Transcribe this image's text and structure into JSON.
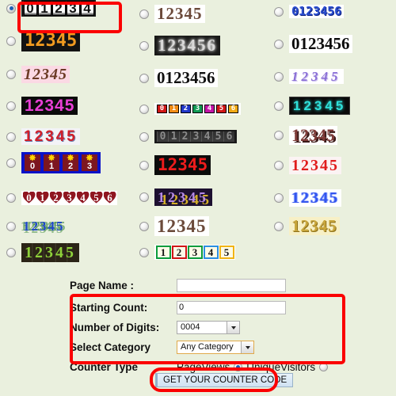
{
  "page": {
    "background_color": "#eaf0de",
    "highlight_color": "#fb0000"
  },
  "gallery": {
    "columns": [
      {
        "name": "column-1",
        "items": [
          {
            "id": "odometer-white",
            "sample": "01234",
            "digits": [
              "0",
              "1",
              "2",
              "3",
              "4"
            ],
            "selected": true,
            "highlighted": true
          },
          {
            "id": "lcd-orange",
            "sample": "12345",
            "selected": false
          },
          {
            "id": "lipstick-pink",
            "sample": "12345",
            "selected": false
          },
          {
            "id": "neon-magenta",
            "sample": "12345",
            "selected": false
          },
          {
            "id": "red-3d",
            "sample": "12345",
            "selected": false
          },
          {
            "id": "flower-pots-blue",
            "sample": "0123",
            "digits": [
              "0",
              "1",
              "2",
              "3"
            ],
            "selected": false
          },
          {
            "id": "hearts-red",
            "sample": "0123456",
            "digits": [
              "0",
              "1",
              "2",
              "3",
              "4",
              "5",
              "6"
            ],
            "selected": false
          },
          {
            "id": "christmas-trees",
            "sample": "12345",
            "selected": false
          },
          {
            "id": "grass-green-dark",
            "sample": "12345",
            "selected": false
          }
        ]
      },
      {
        "name": "column-2",
        "items": [
          {
            "id": "brown-serif",
            "sample": "12345",
            "selected": false
          },
          {
            "id": "smoke-black",
            "sample": "123456",
            "selected": false
          },
          {
            "id": "stencil-bold",
            "sample": "0123456",
            "selected": false
          },
          {
            "id": "color-blocks",
            "sample": "0123456",
            "digits": [
              "0",
              "1",
              "2",
              "3",
              "4",
              "5",
              "6"
            ],
            "selected": false
          },
          {
            "id": "mechanical-dark",
            "sample": "0123456",
            "digits": [
              "0",
              "1",
              "2",
              "3",
              "4",
              "5",
              "6"
            ],
            "selected": false
          },
          {
            "id": "led-red",
            "sample": "12345",
            "selected": false
          },
          {
            "id": "stars-purple",
            "sample": "12345",
            "selected": false
          },
          {
            "id": "brown-bold",
            "sample": "12345",
            "selected": false
          },
          {
            "id": "playing-cards",
            "sample": "12345",
            "digits": [
              "1",
              "2",
              "3",
              "4",
              "5"
            ],
            "selected": false
          }
        ]
      },
      {
        "name": "column-3",
        "items": [
          {
            "id": "pixel-blue",
            "sample": "0123456",
            "selected": false
          },
          {
            "id": "bodoni-black",
            "sample": "0123456",
            "selected": false
          },
          {
            "id": "violet-italic",
            "sample": "12345",
            "selected": false
          },
          {
            "id": "cyan-glow",
            "sample": "12345",
            "selected": false
          },
          {
            "id": "maroon-shadow",
            "sample": "12345",
            "selected": false
          },
          {
            "id": "red-serif",
            "sample": "12345",
            "selected": false
          },
          {
            "id": "blue-dotted",
            "sample": "12345",
            "selected": false
          },
          {
            "id": "gold-mesh",
            "sample": "12345",
            "selected": false
          }
        ]
      }
    ]
  },
  "form": {
    "page_name": {
      "label": "Page Name :",
      "value": ""
    },
    "starting_count": {
      "label": "Starting Count:",
      "value": "0"
    },
    "number_of_digits": {
      "label": "Number of Digits:",
      "value": "0004"
    },
    "select_category": {
      "label": "Select Category",
      "value": "Any Category"
    },
    "counter_type": {
      "label": "Counter Type",
      "option_pageviews": "PageViews",
      "option_uniquevisitors": "UniqueVisitors",
      "selected": "PageViews"
    },
    "submit_button": {
      "label": "GET YOUR COUNTER CODE"
    }
  }
}
